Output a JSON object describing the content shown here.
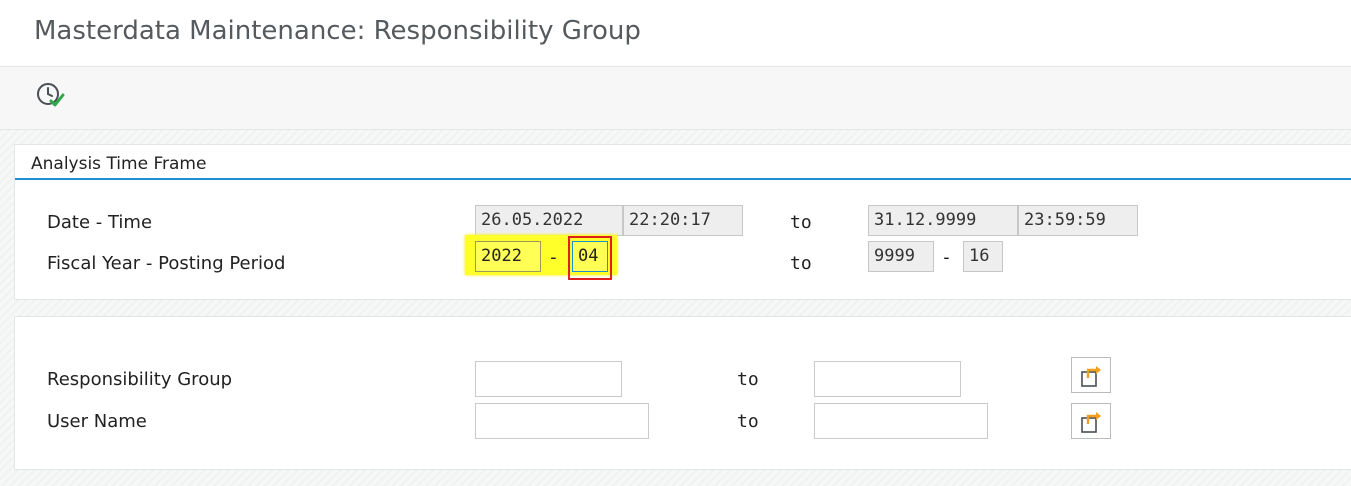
{
  "window": {
    "title": "Masterdata Maintenance: Responsibility Group"
  },
  "toolbar": {
    "execute_icon": "execute-clock-check-icon"
  },
  "analysis_time_frame": {
    "title": "Analysis Time Frame",
    "date_time": {
      "label": "Date - Time",
      "from_date": "26.05.2022",
      "from_time": "22:20:17",
      "to_label": "to",
      "to_date": "31.12.9999",
      "to_time": "23:59:59"
    },
    "fiscal": {
      "label": "Fiscal Year - Posting Period",
      "from_year": "2022",
      "separator": "-",
      "from_period": "04",
      "to_label": "to",
      "to_year": "9999",
      "to_period": "16"
    }
  },
  "selection": {
    "responsibility_group": {
      "label": "Responsibility Group",
      "from_value": "",
      "to_label": "to",
      "to_value": "",
      "multi_icon": "multiple-selection-icon"
    },
    "user_name": {
      "label": "User Name",
      "from_value": "",
      "to_label": "to",
      "to_value": "",
      "multi_icon": "multiple-selection-icon"
    }
  },
  "colors": {
    "accent_line": "#1e90d0",
    "highlight": "#ffff2a",
    "focus": "#e02020",
    "icon_orange": "#f0a020"
  }
}
